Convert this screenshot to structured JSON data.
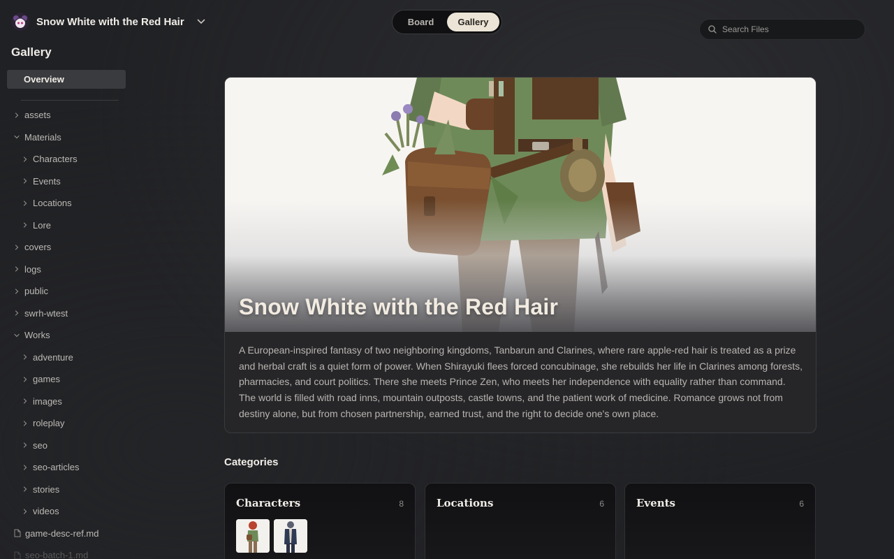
{
  "header": {
    "project_name": "Snow White with the Red Hair",
    "view_tabs": [
      {
        "label": "Board",
        "active": false
      },
      {
        "label": "Gallery",
        "active": true
      }
    ],
    "search": {
      "placeholder": "Search Files",
      "value": ""
    }
  },
  "sidebar": {
    "title": "Gallery",
    "overview_label": "Overview",
    "tree": [
      {
        "label": "assets",
        "level": 0,
        "expanded": false
      },
      {
        "label": "Materials",
        "level": 0,
        "expanded": true
      },
      {
        "label": "Characters",
        "level": 1,
        "expanded": false
      },
      {
        "label": "Events",
        "level": 1,
        "expanded": false
      },
      {
        "label": "Locations",
        "level": 1,
        "expanded": false
      },
      {
        "label": "Lore",
        "level": 1,
        "expanded": false
      },
      {
        "label": "covers",
        "level": 0,
        "expanded": false
      },
      {
        "label": "logs",
        "level": 0,
        "expanded": false
      },
      {
        "label": "public",
        "level": 0,
        "expanded": false
      },
      {
        "label": "swrh-wtest",
        "level": 0,
        "expanded": false
      },
      {
        "label": "Works",
        "level": 0,
        "expanded": true
      },
      {
        "label": "adventure",
        "level": 1,
        "expanded": false
      },
      {
        "label": "games",
        "level": 1,
        "expanded": false
      },
      {
        "label": "images",
        "level": 1,
        "expanded": false
      },
      {
        "label": "roleplay",
        "level": 1,
        "expanded": false
      },
      {
        "label": "seo",
        "level": 1,
        "expanded": false
      },
      {
        "label": "seo-articles",
        "level": 1,
        "expanded": false
      },
      {
        "label": "stories",
        "level": 1,
        "expanded": false
      },
      {
        "label": "videos",
        "level": 1,
        "expanded": false
      }
    ],
    "files": [
      "game-desc-ref.md",
      "seo-batch-1.md"
    ]
  },
  "hero": {
    "title": "Snow White with the Red Hair",
    "description": "A European-inspired fantasy of two neighboring kingdoms, Tanbarun and Clarines, where rare apple-red hair is treated as a prize and herbal craft is a quiet form of power. When Shirayuki flees forced concubinage, she rebuilds her life in Clarines among forests, pharmacies, and court politics. There she meets Prince Zen, who meets her independence with equality rather than command. The world is filled with road inns, mountain outposts, castle towns, and the patient work of medicine. Romance grows not from destiny alone, but from chosen partnership, earned trust, and the right to decide one's own place."
  },
  "categories": {
    "title": "Categories",
    "items": [
      {
        "name": "Characters",
        "count": "8"
      },
      {
        "name": "Locations",
        "count": "6"
      },
      {
        "name": "Events",
        "count": "6"
      }
    ]
  },
  "colors": {
    "background": "#202124",
    "accent_active_tab": "#ece4d6",
    "sidebar_selected": "#3a3b3e"
  }
}
